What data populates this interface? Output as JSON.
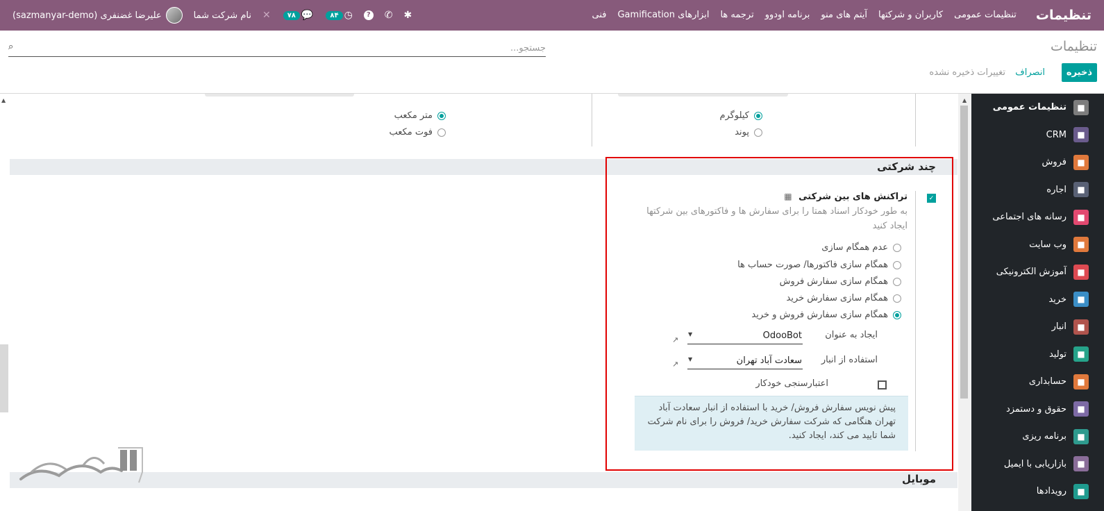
{
  "navbar": {
    "brand": "تنظیمات",
    "menu": [
      "تنظیمات عمومی",
      "کاربران و شرکتها",
      "آیتم های منو",
      "برنامه اودوو",
      "ترجمه ها",
      "ابزارهای Gamification",
      "فنی"
    ],
    "company": "نام شرکت شما",
    "user": "علیرضا غضنفری (sazmanyar-demo)",
    "messages_count": "۷۸",
    "activities_count": "۸۴"
  },
  "control_panel": {
    "title": "تنظیمات",
    "search_placeholder": "جستجو...",
    "save_label": "ذخیره",
    "discard_label": "انصراف",
    "unsaved_label": "تغییرات ذخیره نشده"
  },
  "sidebar": {
    "items": [
      {
        "label": "تنظیمات عمومی",
        "icon": "gear-icon",
        "color": "#7d7d7d"
      },
      {
        "label": "CRM",
        "icon": "handshake-icon",
        "color": "#6a5b8c"
      },
      {
        "label": "فروش",
        "icon": "chart-icon",
        "color": "#e0793c"
      },
      {
        "label": "اجاره",
        "icon": "calendar-icon",
        "color": "#596175"
      },
      {
        "label": "رسانه های اجتماعی",
        "icon": "thumbs-up-icon",
        "color": "#e24970"
      },
      {
        "label": "وب سایت",
        "icon": "globe-icon",
        "color": "#e0793c"
      },
      {
        "label": "آموزش الکترونیکی",
        "icon": "slides-icon",
        "color": "#dd4a52"
      },
      {
        "label": "خرید",
        "icon": "credit-card-icon",
        "color": "#3b8ec6"
      },
      {
        "label": "انبار",
        "icon": "box-icon",
        "color": "#b0544d"
      },
      {
        "label": "تولید",
        "icon": "wrench-icon",
        "color": "#26a38a"
      },
      {
        "label": "حسابداری",
        "icon": "dollar-icon",
        "color": "#e0793c"
      },
      {
        "label": "حقوق و دستمزد",
        "icon": "payroll-icon",
        "color": "#7d6aa5"
      },
      {
        "label": "برنامه ریزی",
        "icon": "planning-icon",
        "color": "#2e9a8e"
      },
      {
        "label": "بازاریابی با ایمیل",
        "icon": "paper-plane-icon",
        "color": "#8a6d99"
      },
      {
        "label": "رویدادها",
        "icon": "ticket-icon",
        "color": "#1f9b8f"
      }
    ]
  },
  "units": {
    "weight": {
      "options": [
        "کیلوگرم",
        "پوند"
      ],
      "selected": 0
    },
    "volume": {
      "options": [
        "متر مکعب",
        "فوت مکعب"
      ],
      "selected": 0
    }
  },
  "multi_company": {
    "section_title": "چند شرکتی",
    "setting_title": "تراکنش های بین شرکتی",
    "setting_desc": "به طور خودکار اسناد همتا را برای سفارش ها و فاکتورهای بین شرکتها ایجاد کنید",
    "enabled": true,
    "sync_options": [
      "عدم همگام سازی",
      "همگام سازی فاکتورها/ صورت حساب ها",
      "همگام سازی سفارش فروش",
      "همگام سازی سفارش خرید",
      "همگام سازی سفارش فروش و خرید"
    ],
    "sync_selected": 4,
    "create_as_label": "ایجاد به عنوان",
    "create_as_value": "OdooBot",
    "warehouse_label": "استفاده از انبار",
    "warehouse_value": "سعادت آباد تهران",
    "auto_validation_label": "اعتبارسنجی خودکار",
    "auto_validation": false,
    "info_text": "پیش نویس سفارش فروش/ خرید با استفاده از انبار سعادت آباد تهران هنگامی که شرکت سفارش خرید/ فروش را برای نام شرکت شما تایید می کند، ایجاد کنید."
  },
  "mobile_section": {
    "title": "موبایل"
  }
}
